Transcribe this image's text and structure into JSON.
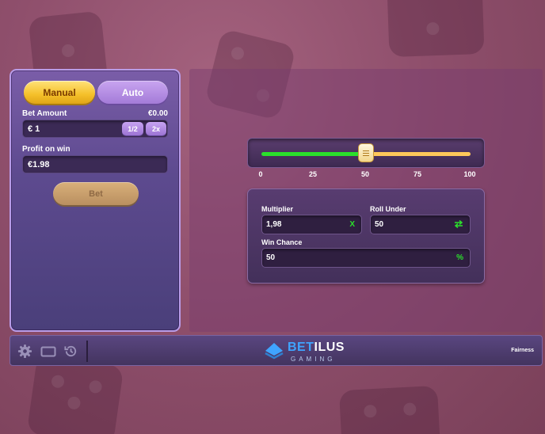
{
  "controls": {
    "mode_manual": "Manual",
    "mode_auto": "Auto",
    "bet_amount_label": "Bet Amount",
    "bet_amount_total": "€0.00",
    "bet_amount_value": "€ 1",
    "half_label": "1/2",
    "double_label": "2x",
    "profit_label": "Profit on win",
    "profit_value": "€1.98",
    "bet_label": "Bet"
  },
  "slider": {
    "value": 50,
    "min": 0,
    "max": 100,
    "ticks": [
      "0",
      "25",
      "50",
      "75",
      "100"
    ]
  },
  "stats": {
    "multiplier_label": "Multiplier",
    "multiplier_value": "1,98",
    "multiplier_suffix": "X",
    "roll_label": "Roll Under",
    "roll_value": "50",
    "win_chance_label": "Win Chance",
    "win_chance_value": "50",
    "win_chance_suffix": "%"
  },
  "footer": {
    "brand_part1": "BET",
    "brand_part2": "ILUS",
    "brand_sub": "GAMING",
    "fairness": "Fairness"
  },
  "icons": [
    "gear-icon",
    "screen-icon",
    "history-icon",
    "swap-arrows-icon",
    "betilus-logo-icon",
    "dice-icon"
  ],
  "colors": {
    "accent_yellow": "#f5c02a",
    "accent_purple": "#a47bd8",
    "win_green": "#2be02b",
    "lose_yellow": "#ffc85a",
    "brand_blue": "#3fa4ff"
  }
}
